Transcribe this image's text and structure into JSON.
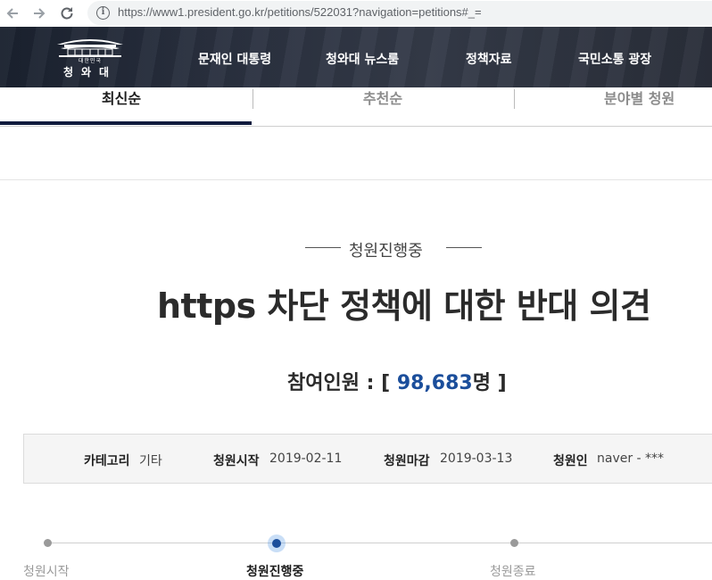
{
  "browser": {
    "url_text": "https://www1.president.go.kr/petitions/522031?navigation=petitions#_="
  },
  "site": {
    "logo_small": "대한민국",
    "logo_main": "청와대",
    "nav": [
      "문재인 대통령",
      "청와대 뉴스룸",
      "정책자료",
      "국민소통 광장"
    ]
  },
  "tabs": [
    {
      "label": "최신순",
      "active": true
    },
    {
      "label": "추천순",
      "active": false
    },
    {
      "label": "분야별 청원",
      "active": false
    }
  ],
  "petition": {
    "status": "청원진행중",
    "title": "https 차단 정책에 대한 반대 의견",
    "participants_label": "참여인원 : [",
    "participants_count": "98,683",
    "participants_unit": "명 ]"
  },
  "info": {
    "category_label": "카테고리",
    "category_value": "기타",
    "start_label": "청원시작",
    "start_value": "2019-02-11",
    "end_label": "청원마감",
    "end_value": "2019-03-13",
    "author_label": "청원인",
    "author_value": "naver - ***"
  },
  "progress": {
    "steps": [
      "청원시작",
      "청원진행중",
      "청원종료"
    ],
    "active_index": 1
  },
  "colors": {
    "accent_blue": "#1b4e9b",
    "header_dark": "#2a3140",
    "tab_underline": "#0f1b3d"
  }
}
